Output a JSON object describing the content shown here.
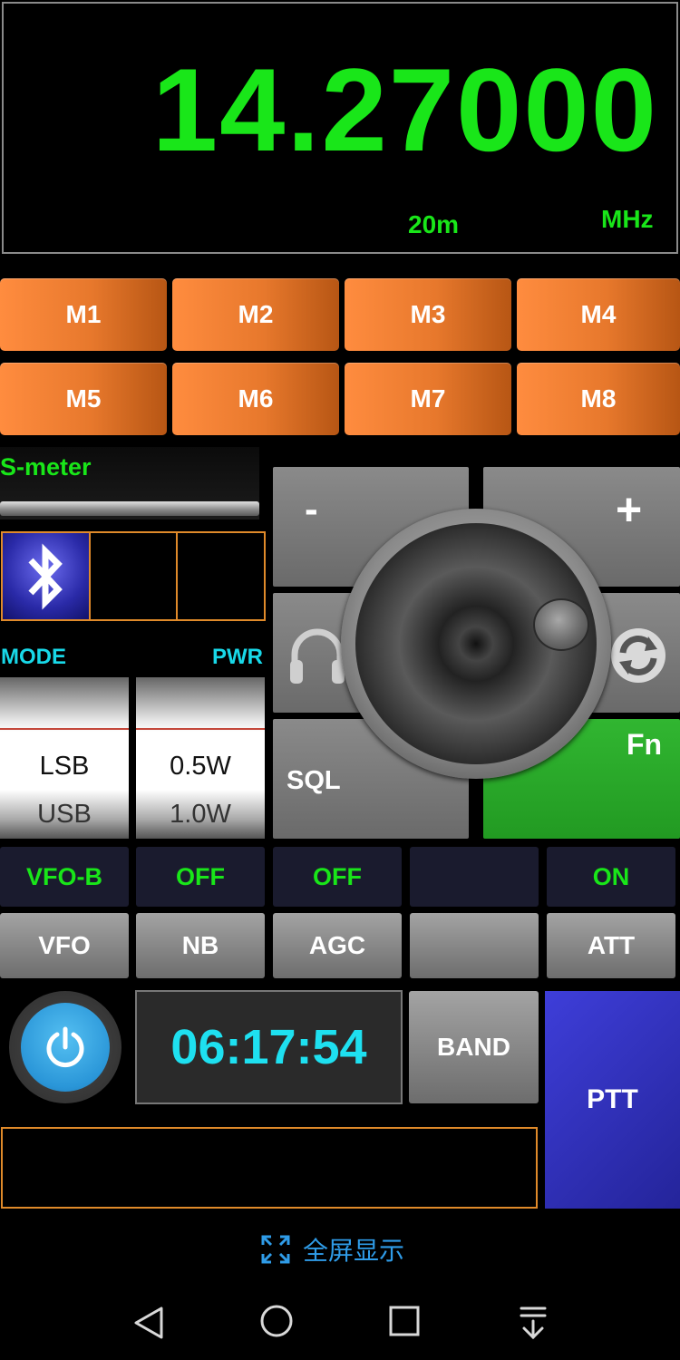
{
  "display": {
    "frequency": "14.27000",
    "band": "20m",
    "unit": "MHz"
  },
  "memories": [
    "M1",
    "M2",
    "M3",
    "M4",
    "M5",
    "M6",
    "M7",
    "M8"
  ],
  "smeter": {
    "label": "S-meter"
  },
  "mode": {
    "label": "MODE",
    "selected": "LSB",
    "next": "USB"
  },
  "power": {
    "label": "PWR",
    "selected": "0.5W",
    "next": "1.0W"
  },
  "controls": {
    "minus": "-",
    "plus": "+",
    "sql": "SQL",
    "fn": "Fn"
  },
  "status_row": [
    "VFO-B",
    "OFF",
    "OFF",
    "",
    "ON"
  ],
  "function_row": [
    "VFO",
    "NB",
    "AGC",
    "",
    "ATT"
  ],
  "clock": "06:17:54",
  "band_button": "BAND",
  "ptt": "PTT",
  "fullscreen": "全屏显示",
  "colors": {
    "green": "#19e619",
    "cyan": "#18d8e8",
    "orange": "#e7782c",
    "fn_green": "#29a829",
    "ptt_blue": "#2e2eb8",
    "link_blue": "#2f9ce8"
  },
  "icons": [
    "bluetooth-icon",
    "headphones-icon",
    "refresh-icon",
    "power-icon",
    "fullscreen-icon",
    "nav-back-icon",
    "nav-home-icon",
    "nav-recents-icon",
    "nav-down-icon"
  ]
}
